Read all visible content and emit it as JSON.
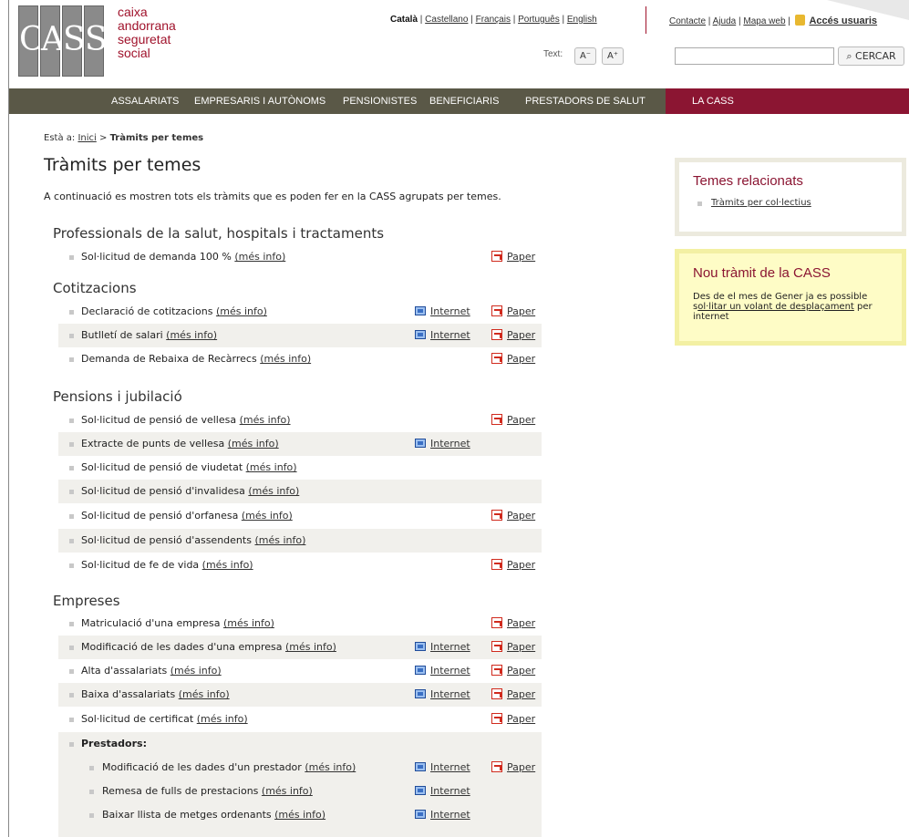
{
  "header": {
    "logo_letters": [
      "C",
      "A",
      "S",
      "S"
    ],
    "logo_lines": [
      "caixa",
      "andorrana",
      "seguretat",
      "social"
    ],
    "lang_active": "Català",
    "langs": [
      "Castellano",
      "Français",
      "Português",
      "English"
    ],
    "util_links": [
      "Contacte",
      "Ajuda",
      "Mapa web"
    ],
    "login": "Accés usuaris",
    "text_label": "Text:",
    "text_smaller": "A⁻",
    "text_bigger": "A⁺",
    "search_value": "",
    "search_button": "CERCAR"
  },
  "nav": {
    "items": [
      "ASSALARIATS",
      "EMPRESARIS I AUTÒNOMS",
      "PENSIONISTES",
      "BENEFICIARIS",
      "PRESTADORS DE SALUT"
    ],
    "active": "LA CASS"
  },
  "breadcrumb": {
    "prefix": "Està a:",
    "home": "Inici",
    "sep": ">",
    "current": "Tràmits per temes"
  },
  "page": {
    "title": "Tràmits per temes",
    "intro": "A continuació es mostren tots els tràmits que es poden fer en la CASS agrupats per temes.",
    "more": "(més info)",
    "internet": "Internet",
    "paper": "Paper"
  },
  "sections": [
    {
      "title": "Professionals de la salut, hospitals i tractaments",
      "rows": [
        {
          "label": "Sol·licitud de demanda 100 %",
          "internet": false,
          "paper": true
        }
      ]
    },
    {
      "title": "Cotitzacions",
      "rows": [
        {
          "label": "Declaració de cotitzacions",
          "internet": true,
          "paper": true
        },
        {
          "label": "Butlletí de salari",
          "internet": true,
          "paper": true
        },
        {
          "label": "Demanda de Rebaixa de Recàrrecs",
          "internet": false,
          "paper": true
        }
      ]
    },
    {
      "title": "Pensions i jubilació",
      "rows": [
        {
          "label": "Sol·licitud de pensió de vellesa",
          "internet": false,
          "paper": true
        },
        {
          "label": "Extracte de punts de vellesa",
          "internet": true,
          "paper": false
        },
        {
          "label": "Sol·licitud de pensió de viudetat",
          "internet": false,
          "paper": false
        },
        {
          "label": "Sol·licitud de pensió d'invalidesa",
          "internet": false,
          "paper": false
        },
        {
          "label": "Sol·licitud de pensió d'orfanesa",
          "internet": false,
          "paper": true
        },
        {
          "label": "Sol·licitud de pensió d'assendents",
          "internet": false,
          "paper": false
        },
        {
          "label": "Sol·licitud de fe de vida",
          "internet": false,
          "paper": true
        }
      ]
    },
    {
      "title": "Empreses",
      "rows": [
        {
          "label": "Matriculació d'una empresa",
          "internet": false,
          "paper": true
        },
        {
          "label": "Modificació de les dades d'una empresa",
          "internet": true,
          "paper": true
        },
        {
          "label": "Alta d'assalariats",
          "internet": true,
          "paper": true
        },
        {
          "label": "Baixa d'assalariats",
          "internet": true,
          "paper": true
        },
        {
          "label": "Sol·licitud de certificat",
          "internet": false,
          "paper": true
        }
      ]
    }
  ],
  "prestadors": {
    "title": "Prestadors:",
    "rows": [
      {
        "label": "Modificació de les dades d'un prestador",
        "internet": true,
        "paper": true
      },
      {
        "label": "Remesa de fulls de prestacions",
        "internet": true,
        "paper": false
      },
      {
        "label": "Baixar llista de metges ordenants",
        "internet": true,
        "paper": false
      }
    ]
  },
  "sidebar": {
    "related_title": "Temes relacionats",
    "related_link": "Tràmits per col·lectius",
    "new_title": "Nou tràmit de la CASS",
    "new_text_a": "Des de el mes de Gener ja es possible s",
    "new_link": "ol·litar un volant de desplaçament",
    "new_text_b": " per internet"
  }
}
